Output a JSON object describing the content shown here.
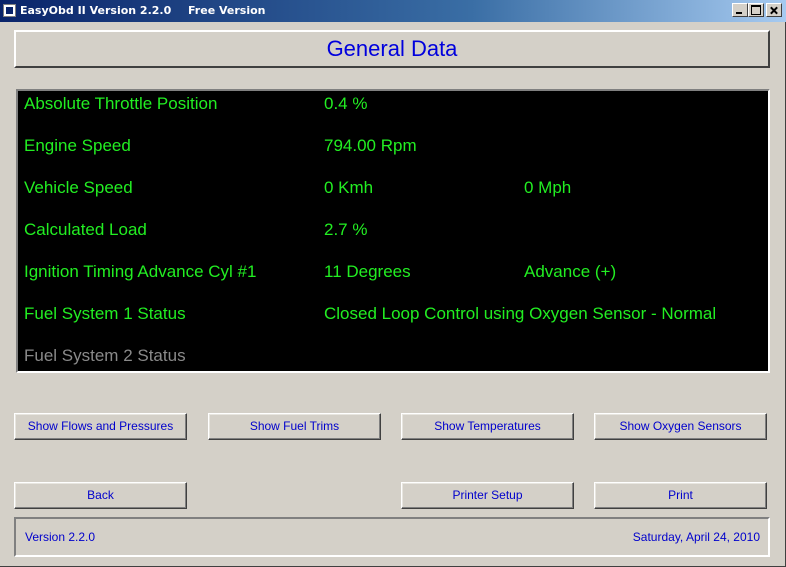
{
  "window": {
    "title": "EasyObd II Version 2.2.0",
    "edition": "Free Version",
    "icons": [
      "app-icon",
      "minimize-icon",
      "maximize-icon",
      "close-icon"
    ]
  },
  "header": {
    "title": "General Data"
  },
  "rows": [
    {
      "label": "Absolute Throttle Position",
      "value": "0.4 %",
      "extra": ""
    },
    {
      "label": "Engine Speed",
      "value": "794.00 Rpm",
      "extra": ""
    },
    {
      "label": "Vehicle Speed",
      "value": "0 Kmh",
      "extra": "0 Mph"
    },
    {
      "label": "Calculated Load",
      "value": "2.7 %",
      "extra": ""
    },
    {
      "label": "Ignition Timing Advance Cyl #1",
      "value": "11 Degrees",
      "extra": "Advance (+)"
    },
    {
      "label": "Fuel System 1 Status",
      "value": "Closed Loop Control using Oxygen Sensor - Normal",
      "extra": ""
    },
    {
      "label": "Fuel System 2 Status",
      "value": "",
      "extra": "",
      "disabled": true
    }
  ],
  "buttons": {
    "flows": "Show Flows and Pressures",
    "fuel_trims": "Show Fuel Trims",
    "temperatures": "Show Temperatures",
    "oxygen": "Show Oxygen Sensors",
    "back": "Back",
    "printer_setup": "Printer Setup",
    "print": "Print"
  },
  "status": {
    "version": "Version 2.2.0",
    "date": "Saturday, April 24, 2010"
  },
  "colors": {
    "value_text": "#22ee22",
    "disabled_text": "#8a8a8a",
    "accent_text": "#0000cc",
    "panel_background": "#000000",
    "chrome": "#d4d0c8"
  }
}
